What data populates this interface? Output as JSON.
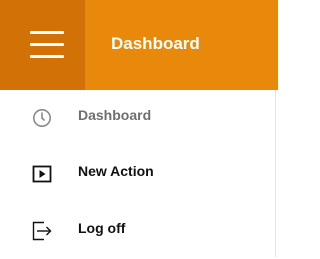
{
  "header": {
    "title": "Dashboard",
    "menu_icon": "hamburger-icon",
    "colors": {
      "background": "#e8890b",
      "menu_button": "#d27206",
      "text": "#ffffff"
    }
  },
  "menu": {
    "items": [
      {
        "label": "Dashboard",
        "icon": "clock-icon",
        "color": "#6f6f6f"
      },
      {
        "label": "New Action",
        "icon": "play-icon",
        "color": "#111111"
      },
      {
        "label": "Log off",
        "icon": "logout-icon",
        "color": "#111111"
      }
    ]
  }
}
